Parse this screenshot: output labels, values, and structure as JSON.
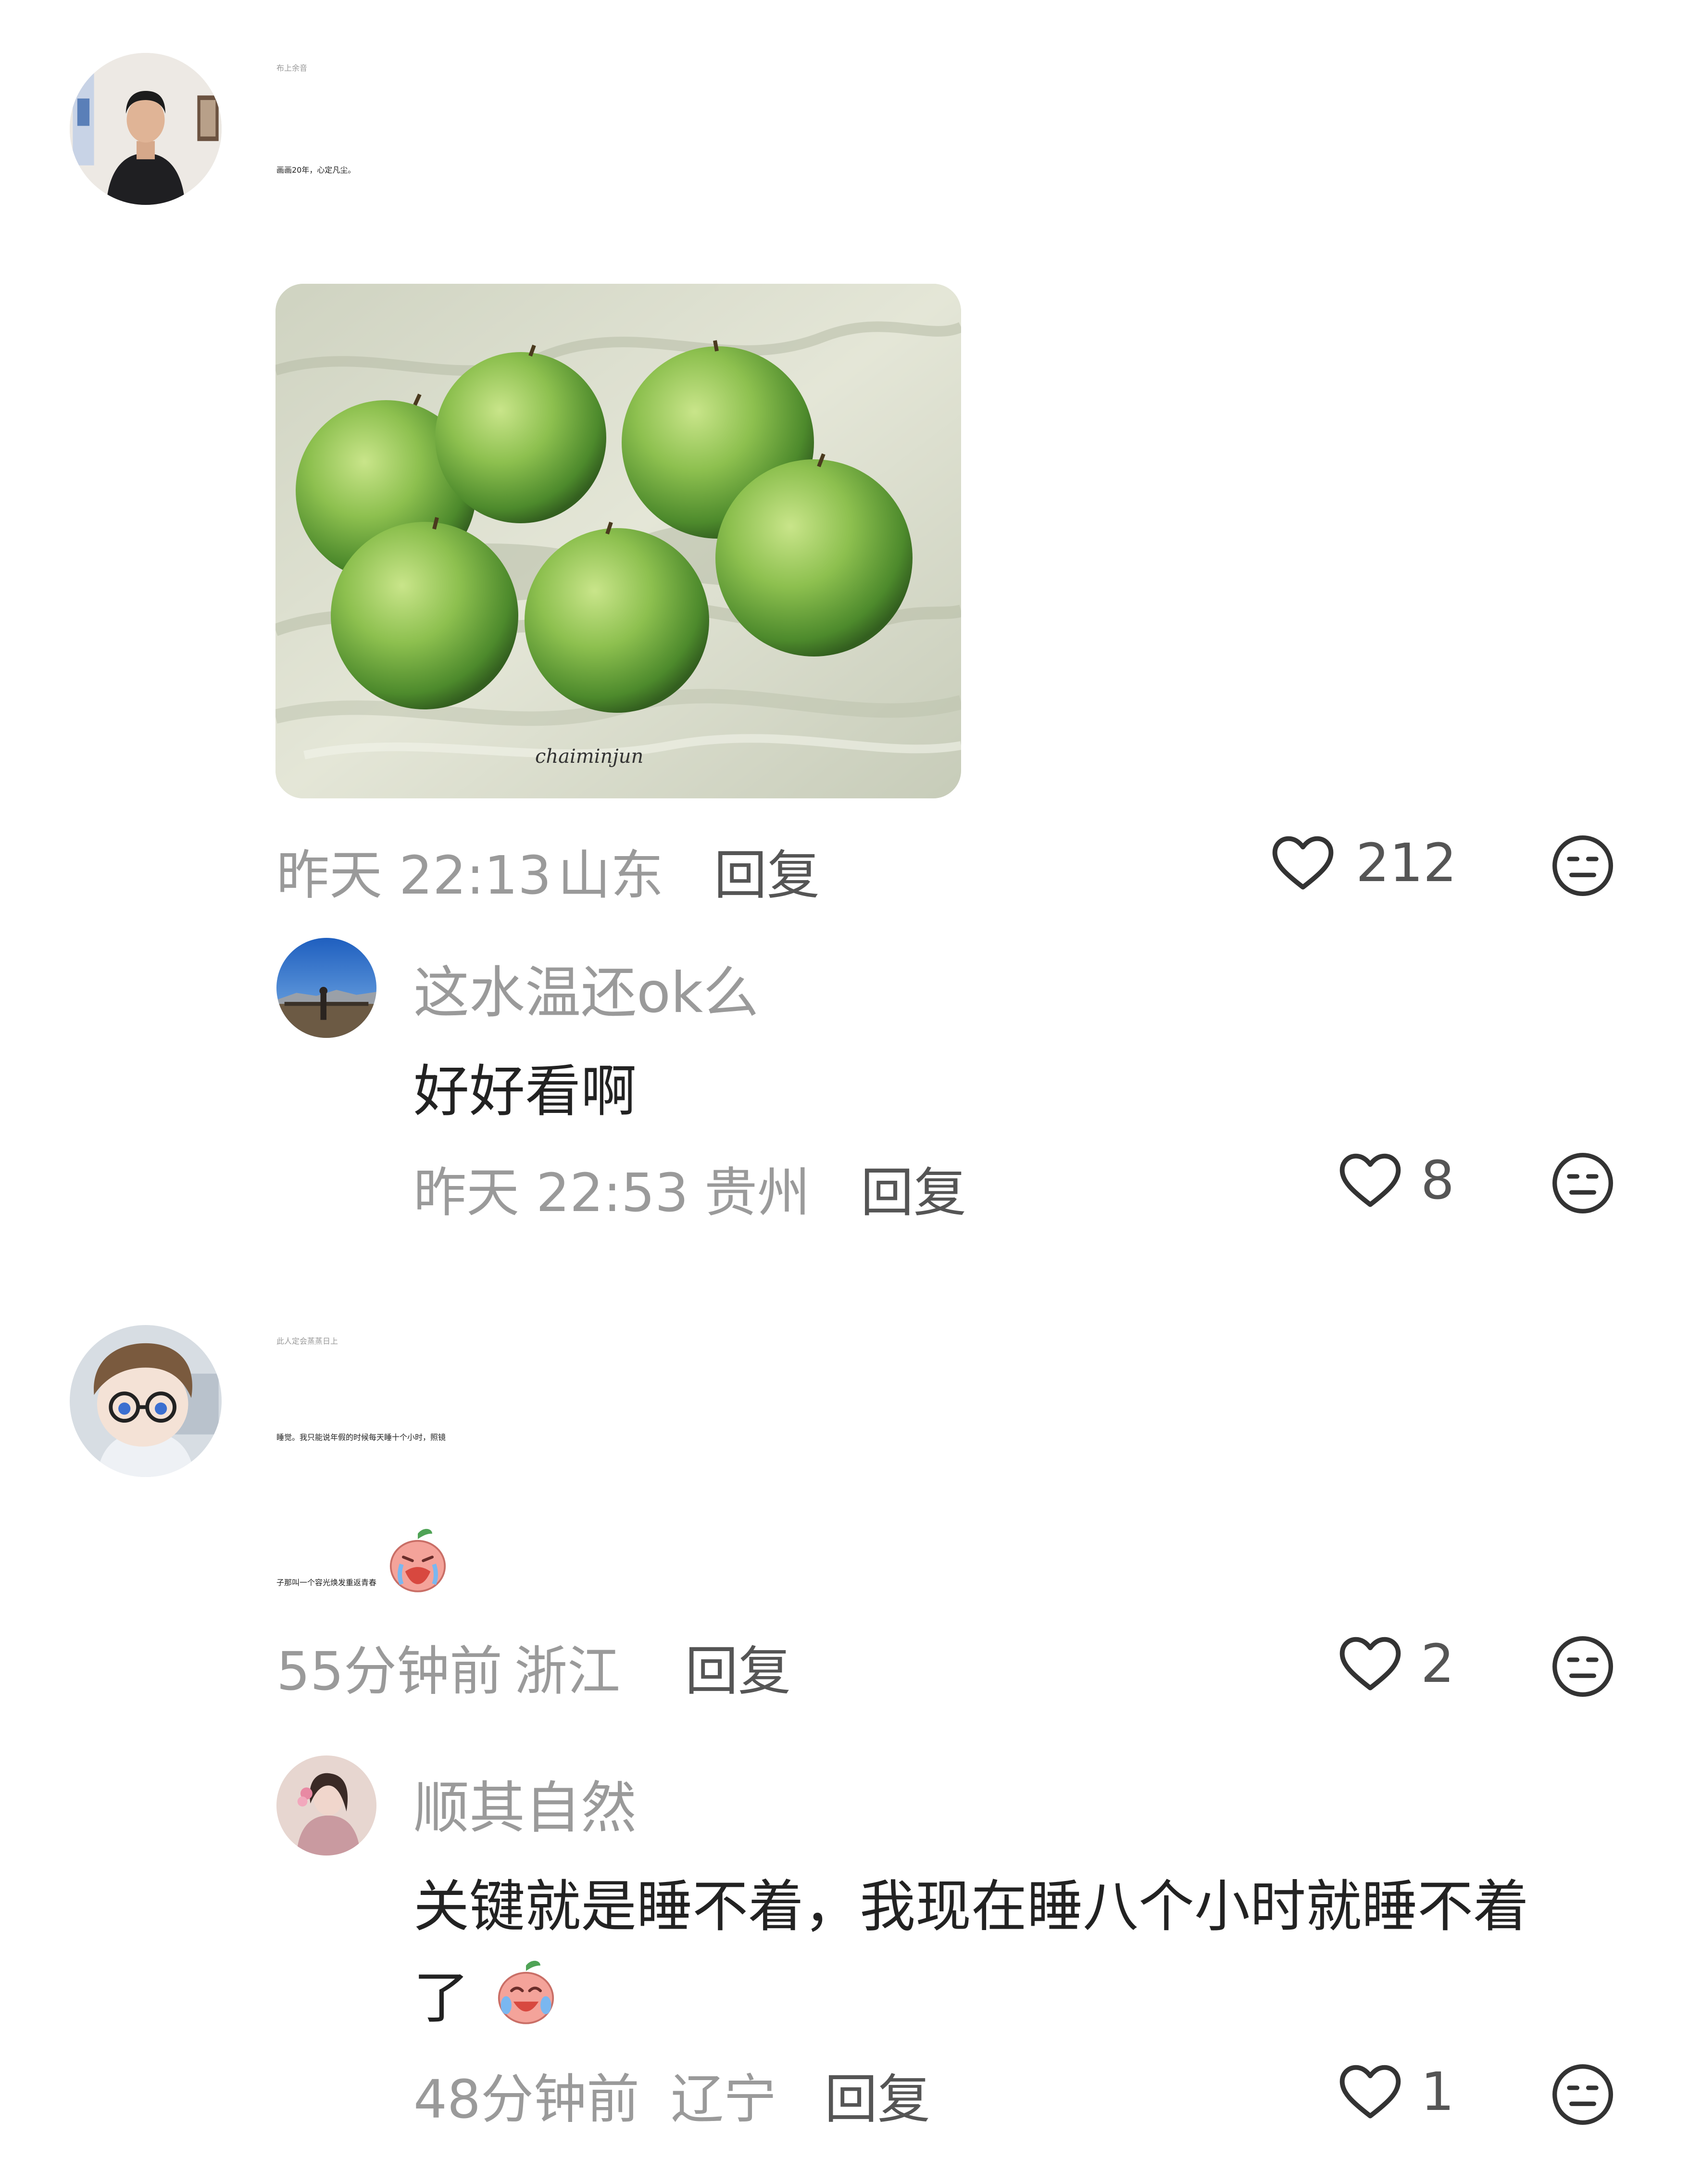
{
  "comments": [
    {
      "username": "布上余音",
      "text": "画画20年，心定凡尘。",
      "image_signature": "chaiminjun",
      "time": "昨天 22:13",
      "location": "山东",
      "reply_label": "回复",
      "likes": "212",
      "replies": [
        {
          "username": "这水温还ok么",
          "text": "好好看啊",
          "time": "昨天 22:53",
          "location": "贵州",
          "reply_label": "回复",
          "likes": "8"
        }
      ]
    },
    {
      "username": "此人定会蒸蒸日上",
      "text_line1": "睡觉。我只能说年假的时候每天睡十个小时，照镜",
      "text_line2": "子那叫一个容光焕发重返青春",
      "time": "55分钟前",
      "location": "浙江",
      "reply_label": "回复",
      "likes": "2",
      "replies": [
        {
          "username": "顺其自然",
          "text_line1": "关键就是睡不着，我现在睡八个小时就睡不着",
          "text_line2": "了",
          "time": "48分钟前",
          "location": "辽宁",
          "reply_label": "回复",
          "likes": "1"
        }
      ]
    }
  ],
  "icons": {
    "like": "heart-outline-icon",
    "dislike": "neutral-face-icon"
  },
  "colors": {
    "text": "#222222",
    "muted": "#9a9a9a",
    "icon": "#333333"
  }
}
